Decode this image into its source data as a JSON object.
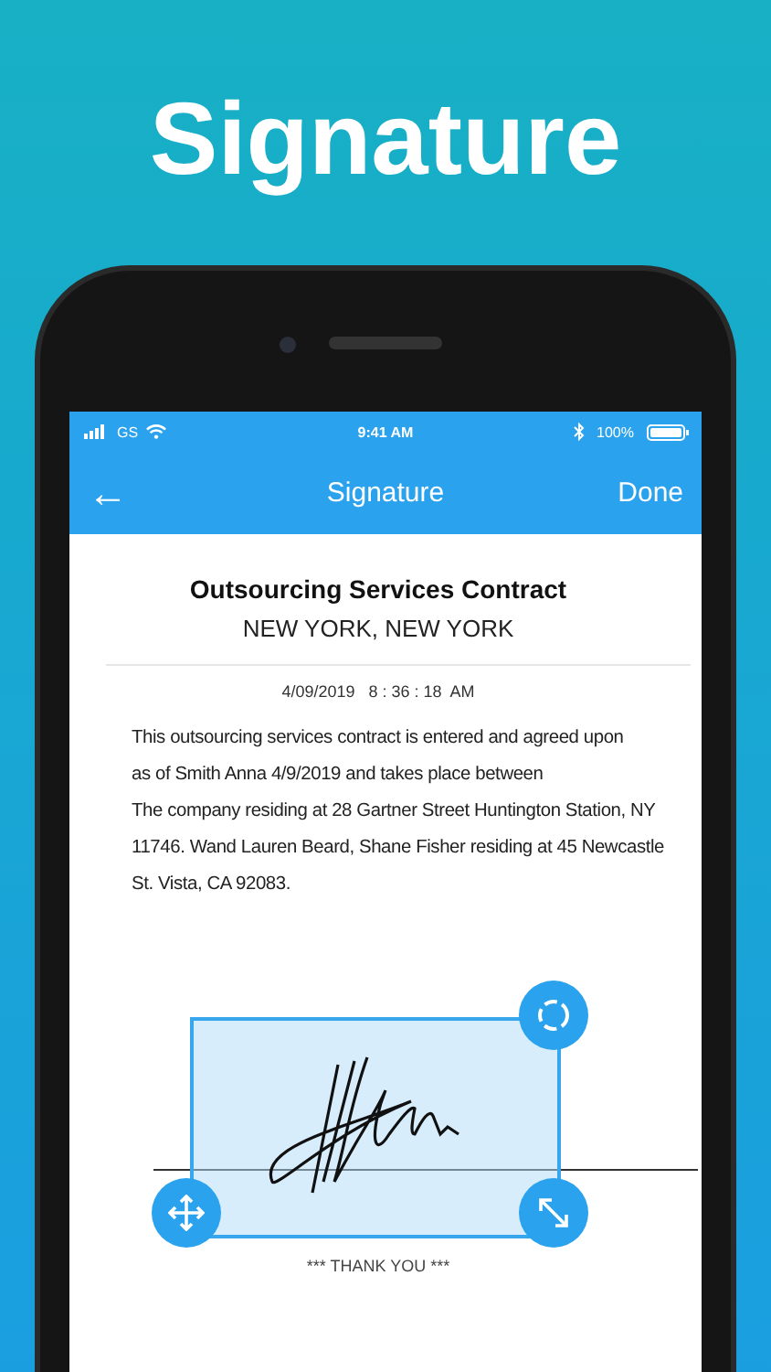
{
  "headline": "Signature",
  "status_bar": {
    "carrier": "GS",
    "time": "9:41 AM",
    "battery": "100%"
  },
  "nav": {
    "back": "←",
    "title": "Signature",
    "action": "Done"
  },
  "document": {
    "title": "Outsourcing Services Contract",
    "subtitle": "NEW YORK, NEW YORK",
    "timestamp": "4/09/2019   8 : 36 : 18  AM",
    "lines": [
      "This outsourcing services contract is entered and agreed upon",
      "as of Smith Anna 4/9/2019 and takes place between",
      "The company residing at 28 Gartner Street Huntington Station, NY",
      "11746. Wand Lauren Beard, Shane Fisher residing at 45 Newcastle",
      "St. Vista, CA 92083."
    ],
    "footer": "*** THANK YOU ***"
  }
}
